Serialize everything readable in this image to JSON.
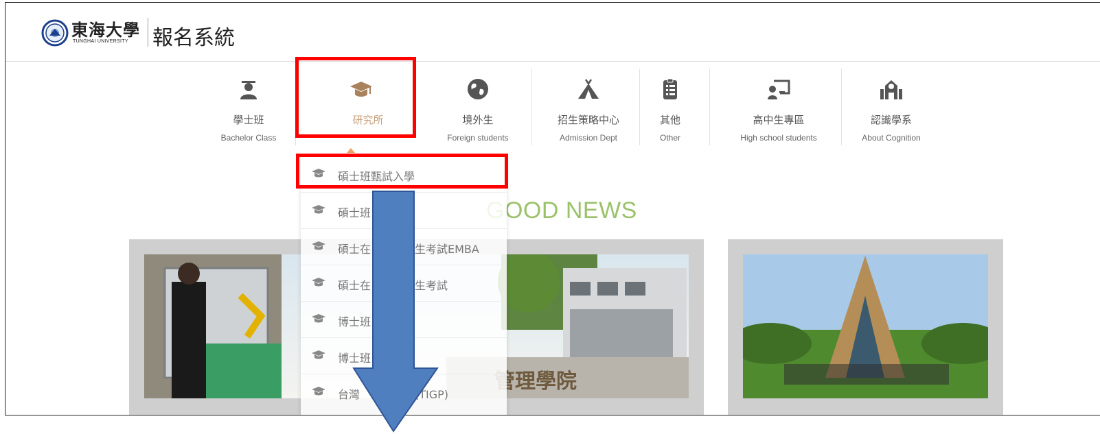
{
  "header": {
    "university_name": "東海大學",
    "university_en": "TUNGHAI UNIVERSITY",
    "system_title": "報名系統"
  },
  "nav": {
    "items": [
      {
        "zh": "學士班",
        "en": "Bachelor Class",
        "icon": "graduate-student-icon"
      },
      {
        "zh": "研究所",
        "en": "",
        "icon": "graduation-cap-icon"
      },
      {
        "zh": "境外生",
        "en": "Foreign students",
        "icon": "globe-icon"
      },
      {
        "zh": "招生策略中心",
        "en": "Admission Dept",
        "icon": "tent-icon"
      },
      {
        "zh": "其他",
        "en": "Other",
        "icon": "clipboard-list-icon"
      },
      {
        "zh": "高中生專區",
        "en": "High school students",
        "icon": "presentation-teacher-icon"
      },
      {
        "zh": "認識學系",
        "en": "About Cognition",
        "icon": "school-building-icon"
      }
    ]
  },
  "dropdown": {
    "items": [
      {
        "label": "碩士班甄試入學"
      },
      {
        "label": "碩士班　　　學"
      },
      {
        "label": "碩士在　　　招生考試EMBA"
      },
      {
        "label": "碩士在　　　招生考試"
      },
      {
        "label": "博士班　　　學"
      },
      {
        "label": "博士班　　　學"
      },
      {
        "label": "台灣　　　　程(TIGP)"
      }
    ]
  },
  "news": {
    "title": "GOOD NEWS",
    "photo_caption": "管理學院"
  },
  "colors": {
    "active_nav": "#c9a07a",
    "highlight": "#ff0000",
    "news_title": "#9bc26b",
    "arrow_fill": "#4f7fbf",
    "arrow_stroke": "#2f5597"
  }
}
